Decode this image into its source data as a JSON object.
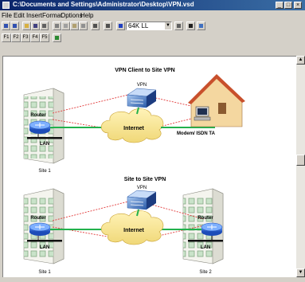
{
  "window": {
    "title": "C:\\Documents and Settings\\Administrator\\Desktop\\VPN.vsd"
  },
  "menu": [
    "File",
    "Edit",
    "Insert",
    "Format",
    "Options",
    "Help"
  ],
  "toolbar": {
    "zoom_value": "64K LL",
    "fkeys": [
      "F1",
      "F2",
      "F3",
      "F4",
      "F5"
    ]
  },
  "diagram1": {
    "title": "VPN Client to Site VPN",
    "vpn_label": "VPN",
    "router_label": "Router",
    "lan_label": "LAN",
    "internet_label": "Internet",
    "modem_label": "Modem/ ISDN TA",
    "site_label": "Site 1"
  },
  "diagram2": {
    "title": "Site to Site VPN",
    "vpn_label": "VPN",
    "internet_label": "Internet",
    "left": {
      "router_label": "Router",
      "lan_label": "LAN",
      "site_label": "Site 1"
    },
    "right": {
      "router_label": "Router",
      "lan_label": "LAN",
      "site_label": "Site 2"
    }
  }
}
